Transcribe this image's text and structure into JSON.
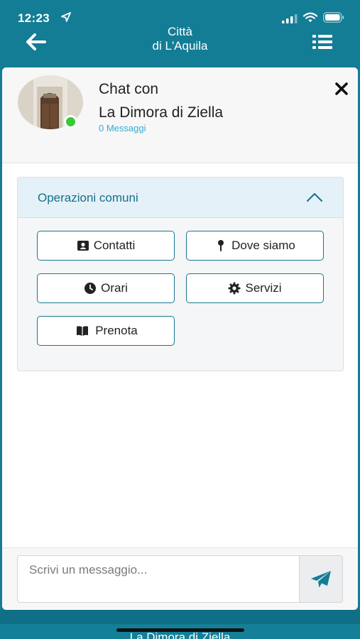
{
  "status_bar": {
    "time": "12:23",
    "icons": [
      "location-arrow-icon",
      "signal-icon",
      "wifi-icon",
      "battery-icon"
    ]
  },
  "nav": {
    "title_line1": "Città",
    "title_line2": "di L'Aquila",
    "back_icon": "arrow-left-icon",
    "menu_icon": "list-icon"
  },
  "chat": {
    "title_line1": "Chat con",
    "title_line2": "La Dimora di Ziella",
    "message_count": "0 Messaggi",
    "online": true,
    "close_icon": "close-icon"
  },
  "panel": {
    "title": "Operazioni comuni",
    "expanded": true,
    "buttons": [
      {
        "label": "Contatti",
        "icon": "contact-card-icon"
      },
      {
        "label": "Dove siamo",
        "icon": "map-pin-icon"
      },
      {
        "label": "Orari",
        "icon": "clock-icon"
      },
      {
        "label": "Servizi",
        "icon": "gear-icon"
      },
      {
        "label": "Prenota",
        "icon": "book-open-icon"
      }
    ]
  },
  "composer": {
    "placeholder": "Scrivi un messaggio...",
    "value": "",
    "send_icon": "paper-plane-icon"
  },
  "footer": {
    "title": "La Dimora di Ziella"
  },
  "colors": {
    "primary": "#137d96",
    "accent_text": "#15708a",
    "link": "#38a9d4",
    "online": "#3ac83a",
    "send_icon": "#137d96"
  }
}
